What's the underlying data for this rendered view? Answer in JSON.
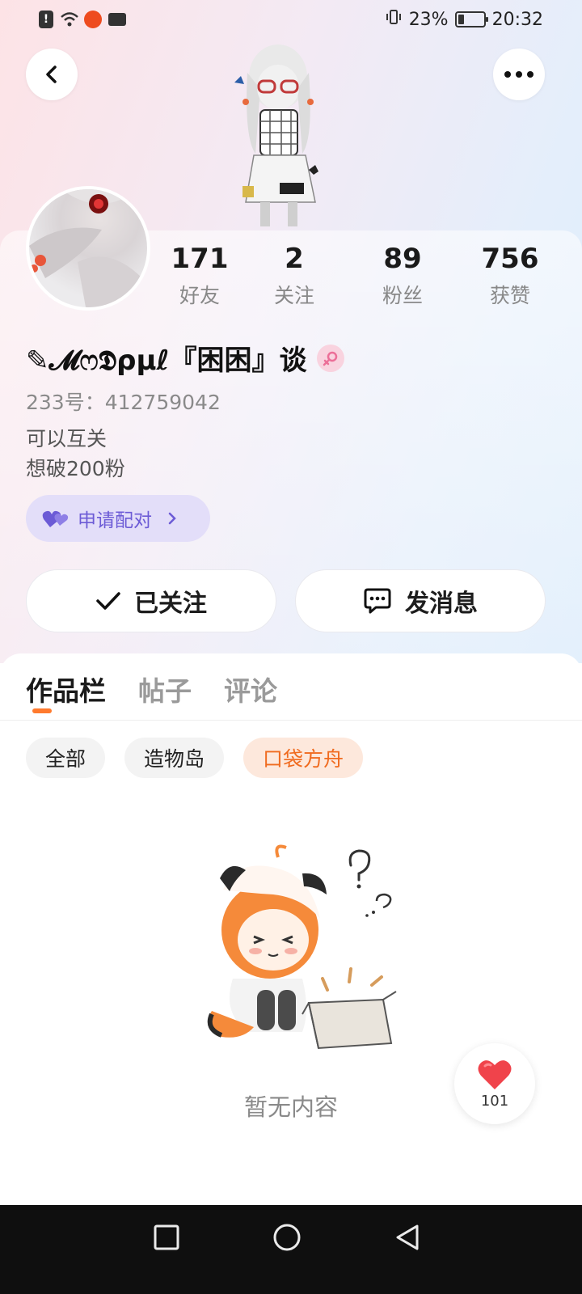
{
  "status_bar": {
    "battery_percent": "23%",
    "time": "20:32"
  },
  "header": {
    "back_icon": "chevron-left-icon",
    "more_icon": "more-horizontal-icon"
  },
  "stats": [
    {
      "value": "171",
      "label": "好友"
    },
    {
      "value": "2",
      "label": "关注"
    },
    {
      "value": "89",
      "label": "粉丝"
    },
    {
      "value": "756",
      "label": "获赞"
    }
  ],
  "profile": {
    "name": "✎𝓜ෆ𝕯ρμℓ『困困』谈",
    "gender": "female",
    "uid": "233号：412759042",
    "bio_line1": "可以互关",
    "bio_line2": "想破200粉",
    "pair_label": "申请配对"
  },
  "actions": {
    "follow_label": "已关注",
    "message_label": "发消息"
  },
  "tabs": [
    {
      "label": "作品栏",
      "active": true
    },
    {
      "label": "帖子",
      "active": false
    },
    {
      "label": "评论",
      "active": false
    }
  ],
  "filters": [
    {
      "label": "全部",
      "selected": false
    },
    {
      "label": "造物岛",
      "selected": false
    },
    {
      "label": "口袋方舟",
      "selected": true
    }
  ],
  "empty_state": {
    "text": "暂无内容"
  },
  "like_fab": {
    "count": "101"
  },
  "colors": {
    "accent_orange": "#ff7a2e",
    "pair_purple": "#6c5bd6",
    "heart_red": "#f0434b"
  }
}
